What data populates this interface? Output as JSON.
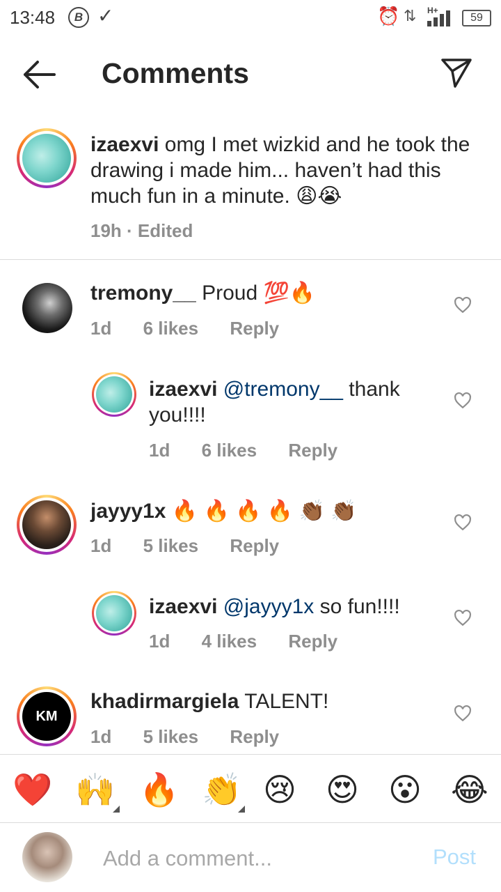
{
  "status_bar": {
    "time": "13:48",
    "b_badge": "B",
    "battery": "59",
    "network": "H+"
  },
  "header": {
    "title": "Comments"
  },
  "caption": {
    "username": "izaexvi",
    "text": " omg I met wizkid and he took the drawing i made him... haven’t had this much fun in a minute. 😩😭",
    "time": "19h",
    "edited": "Edited"
  },
  "comments": [
    {
      "username": "tremony__",
      "text": " Proud 💯🔥",
      "mention": "",
      "time": "1d",
      "likes": "6 likes",
      "reply": "Reply"
    },
    {
      "username": "izaexvi",
      "mention": "@tremony__",
      "text": " thank you!!!!",
      "time": "1d",
      "likes": "6 likes",
      "reply": "Reply"
    },
    {
      "username": "jayyy1x",
      "text": " 🔥 🔥 🔥 🔥 👏🏾 👏🏾",
      "mention": "",
      "time": "1d",
      "likes": "5 likes",
      "reply": "Reply"
    },
    {
      "username": "izaexvi",
      "mention": "@jayyy1x",
      "text": " so fun!!!!",
      "time": "1d",
      "likes": "4 likes",
      "reply": "Reply"
    },
    {
      "username": "khadirmargiela",
      "text": " TALENT!",
      "mention": "",
      "time": "1d",
      "likes": "5 likes",
      "reply": "Reply"
    }
  ],
  "km_logo": "KM",
  "emoji_bar": [
    "❤️",
    "🙌",
    "🔥",
    "👏",
    "😢",
    "😍",
    "😮",
    "😂"
  ],
  "composer": {
    "placeholder": "Add a comment...",
    "post_label": "Post"
  },
  "colors": {
    "link_blue": "#00376b",
    "post_disabled": "#b2dffc",
    "meta_gray": "#8e8e8e"
  }
}
